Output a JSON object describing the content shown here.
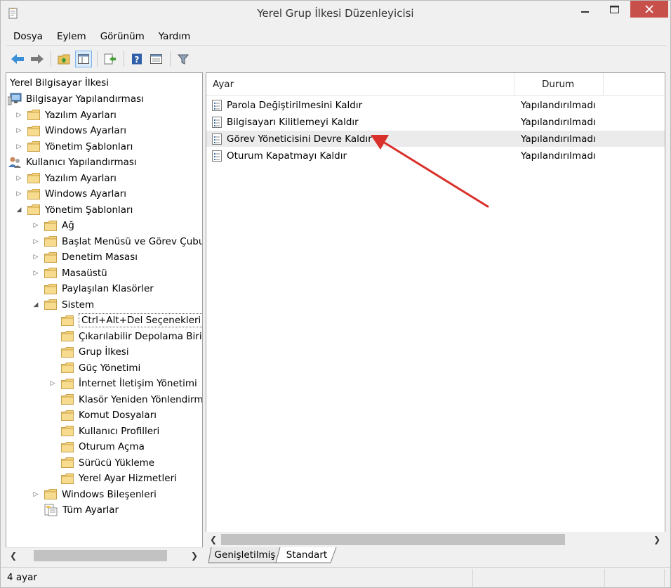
{
  "window": {
    "title": "Yerel Grup İlkesi Düzenleyicisi"
  },
  "menu": [
    "Dosya",
    "Eylem",
    "Görünüm",
    "Yardım"
  ],
  "toolbar": {
    "icons": [
      "back-arrow-icon",
      "forward-arrow-icon",
      "up-folder-icon",
      "show-hide-tree-icon",
      "export-list-icon",
      "help-icon",
      "properties-icon",
      "filter-icon"
    ]
  },
  "tree": {
    "root": "Yerel Bilgisayar İlkesi",
    "items": [
      {
        "label": "Bilgisayar Yapılandırması",
        "level": 0,
        "expander": "",
        "icon": "computer"
      },
      {
        "label": "Yazılım Ayarları",
        "level": 1,
        "expander": "collapsed",
        "icon": "folder"
      },
      {
        "label": "Windows Ayarları",
        "level": 1,
        "expander": "collapsed",
        "icon": "folder"
      },
      {
        "label": "Yönetim Şablonları",
        "level": 1,
        "expander": "collapsed",
        "icon": "folder"
      },
      {
        "label": "Kullanıcı Yapılandırması",
        "level": 0,
        "expander": "",
        "icon": "user"
      },
      {
        "label": "Yazılım Ayarları",
        "level": 1,
        "expander": "collapsed",
        "icon": "folder"
      },
      {
        "label": "Windows Ayarları",
        "level": 1,
        "expander": "collapsed",
        "icon": "folder"
      },
      {
        "label": "Yönetim Şablonları",
        "level": 1,
        "expander": "expanded",
        "icon": "folder"
      },
      {
        "label": "Ağ",
        "level": 2,
        "expander": "collapsed",
        "icon": "folder"
      },
      {
        "label": "Başlat Menüsü ve Görev Çubuğu",
        "level": 2,
        "expander": "collapsed",
        "icon": "folder"
      },
      {
        "label": "Denetim Masası",
        "level": 2,
        "expander": "collapsed",
        "icon": "folder"
      },
      {
        "label": "Masaüstü",
        "level": 2,
        "expander": "collapsed",
        "icon": "folder"
      },
      {
        "label": "Paylaşılan Klasörler",
        "level": 2,
        "expander": "",
        "icon": "folder"
      },
      {
        "label": "Sistem",
        "level": 2,
        "expander": "expanded",
        "icon": "folder"
      },
      {
        "label": "Ctrl+Alt+Del Seçenekleri",
        "level": 3,
        "expander": "",
        "icon": "folder",
        "selected": true
      },
      {
        "label": "Çıkarılabilir Depolama Birimi Erişimi",
        "level": 3,
        "expander": "",
        "icon": "folder"
      },
      {
        "label": "Grup İlkesi",
        "level": 3,
        "expander": "",
        "icon": "folder"
      },
      {
        "label": "Güç Yönetimi",
        "level": 3,
        "expander": "",
        "icon": "folder"
      },
      {
        "label": "İnternet İletişim Yönetimi",
        "level": 3,
        "expander": "collapsed",
        "icon": "folder"
      },
      {
        "label": "Klasör Yeniden Yönlendirme",
        "level": 3,
        "expander": "",
        "icon": "folder"
      },
      {
        "label": "Komut Dosyaları",
        "level": 3,
        "expander": "",
        "icon": "folder"
      },
      {
        "label": "Kullanıcı Profilleri",
        "level": 3,
        "expander": "",
        "icon": "folder"
      },
      {
        "label": "Oturum Açma",
        "level": 3,
        "expander": "",
        "icon": "folder"
      },
      {
        "label": "Sürücü Yükleme",
        "level": 3,
        "expander": "",
        "icon": "folder"
      },
      {
        "label": "Yerel Ayar Hizmetleri",
        "level": 3,
        "expander": "",
        "icon": "folder"
      },
      {
        "label": "Windows Bileşenleri",
        "level": 2,
        "expander": "collapsed",
        "icon": "folder"
      },
      {
        "label": "Tüm Ayarlar",
        "level": 2,
        "expander": "",
        "icon": "all-settings"
      }
    ]
  },
  "list": {
    "columns": {
      "setting": "Ayar",
      "status": "Durum"
    },
    "rows": [
      {
        "setting": "Parola Değiştirilmesini Kaldır",
        "status": "Yapılandırılmadı"
      },
      {
        "setting": "Bilgisayarı Kilitlemeyi Kaldır",
        "status": "Yapılandırılmadı"
      },
      {
        "setting": "Görev Yöneticisini Devre Kaldır",
        "status": "Yapılandırılmadı",
        "highlighted": true
      },
      {
        "setting": "Oturum Kapatmayı Kaldır",
        "status": "Yapılandırılmadı"
      }
    ]
  },
  "tabs": [
    "Genişletilmiş",
    "Standart"
  ],
  "active_tab": "Standart",
  "statusbar": {
    "text": "4 ayar"
  },
  "colors": {
    "annotation_arrow": "#d9302b",
    "close_button": "#c7504b",
    "folder": "#f3d27a"
  }
}
